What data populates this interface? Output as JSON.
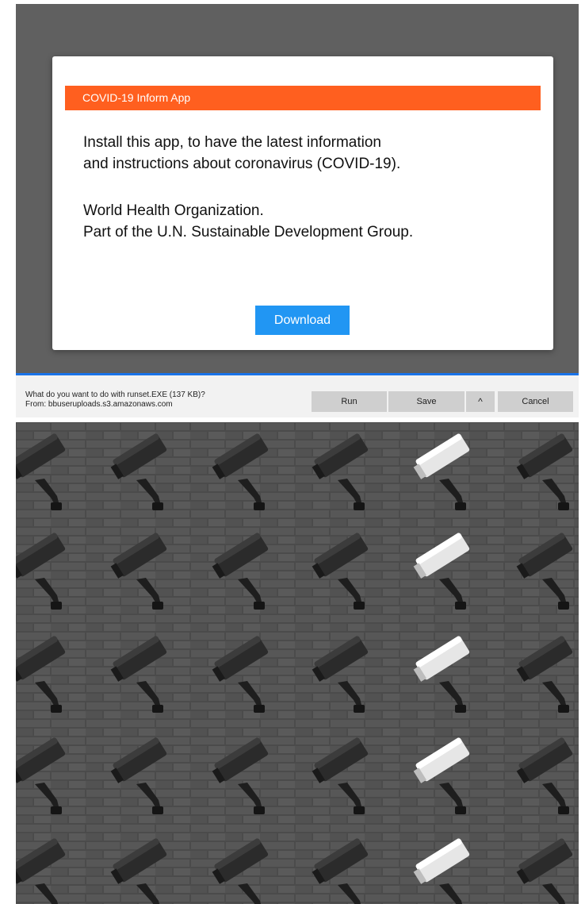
{
  "dialog": {
    "header_title": "COVID-19 Inform App",
    "message_line1": "Install this app, to have the latest information",
    "message_line2": "and instructions about coronavirus (COVID-19).",
    "org_line1": "World Health Organization.",
    "org_line2": "Part of the U.N. Sustainable Development Group.",
    "download_label": "Download",
    "accent_color": "#ff5f1f",
    "button_color": "#2196f3"
  },
  "download_bar": {
    "question": "What do you want to do with runset.EXE (137 KB)?",
    "source": "From: bbuseruploads.s3.amazonaws.com",
    "run_label": "Run",
    "save_label": "Save",
    "more_icon": "chevron-up-icon",
    "more_glyph": "^",
    "cancel_label": "Cancel"
  },
  "photo": {
    "subject": "surveillance-cameras-on-brick-wall"
  }
}
